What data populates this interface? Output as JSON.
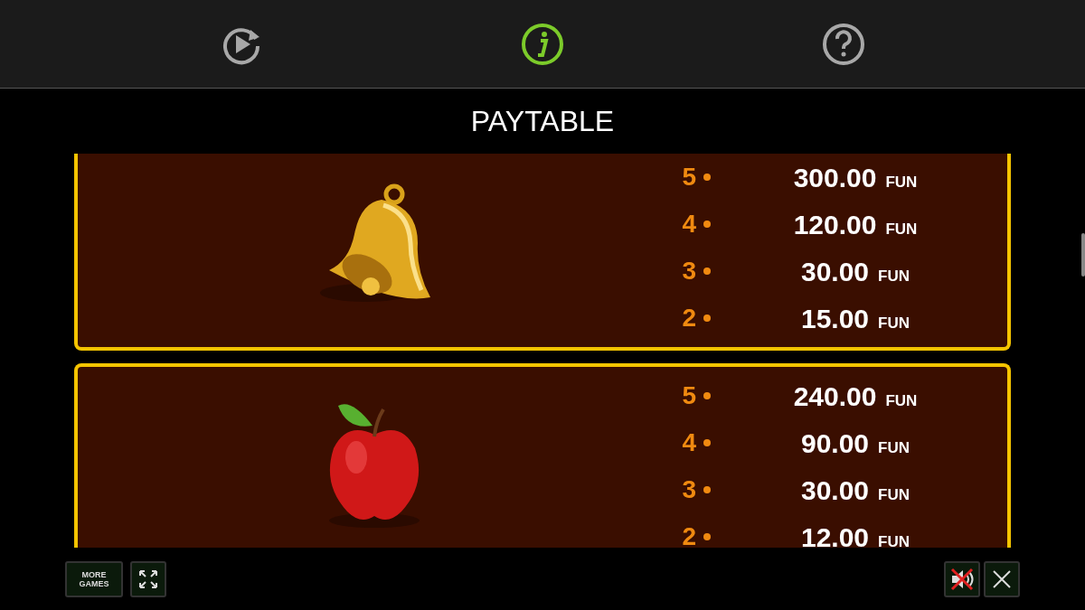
{
  "toolbar": {
    "tabs": [
      {
        "kind": "replay",
        "selected": false
      },
      {
        "kind": "info",
        "selected": true
      },
      {
        "kind": "help",
        "selected": false
      }
    ]
  },
  "title": "PAYTABLE",
  "symbols": [
    {
      "kind": "bell",
      "payouts": [
        {
          "count": "5",
          "amount": "300.00",
          "currency": "FUN"
        },
        {
          "count": "4",
          "amount": "120.00",
          "currency": "FUN"
        },
        {
          "count": "3",
          "amount": "30.00",
          "currency": "FUN"
        },
        {
          "count": "2",
          "amount": "15.00",
          "currency": "FUN"
        }
      ]
    },
    {
      "kind": "apple",
      "payouts": [
        {
          "count": "5",
          "amount": "240.00",
          "currency": "FUN"
        },
        {
          "count": "4",
          "amount": "90.00",
          "currency": "FUN"
        },
        {
          "count": "3",
          "amount": "30.00",
          "currency": "FUN"
        },
        {
          "count": "2",
          "amount": "12.00",
          "currency": "FUN"
        }
      ]
    }
  ],
  "bottom_bar": {
    "more_games": [
      "MORE",
      "GAMES"
    ],
    "sound_muted": true
  }
}
